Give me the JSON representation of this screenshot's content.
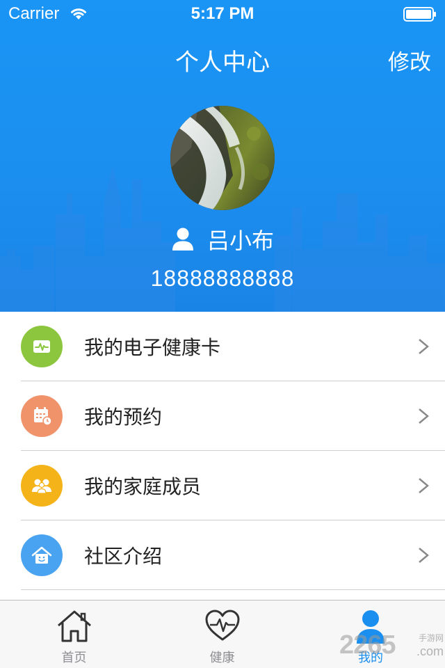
{
  "status_bar": {
    "carrier": "Carrier",
    "time": "5:17 PM"
  },
  "nav": {
    "title": "个人中心",
    "edit": "修改"
  },
  "profile": {
    "name": "吕小布",
    "phone": "18888888888"
  },
  "menu": {
    "items": [
      {
        "label": "我的电子健康卡",
        "icon": "health-card-icon",
        "color": "#8cc63f"
      },
      {
        "label": "我的预约",
        "icon": "calendar-icon",
        "color": "#f0926a"
      },
      {
        "label": "我的家庭成员",
        "icon": "family-icon",
        "color": "#f5b31a"
      },
      {
        "label": "社区介绍",
        "icon": "community-house-icon",
        "color": "#4aa3f0"
      }
    ]
  },
  "tabbar": {
    "tabs": [
      {
        "label": "首页",
        "icon": "home-icon",
        "active": false
      },
      {
        "label": "健康",
        "icon": "heartbeat-icon",
        "active": false
      },
      {
        "label": "我的",
        "icon": "user-icon",
        "active": true
      }
    ]
  },
  "watermark": {
    "digits": "2265",
    "site": "手游网",
    "domain": ".com"
  },
  "colors": {
    "header_blue": "#1a95f5",
    "active_tab": "#1a8ff0"
  }
}
